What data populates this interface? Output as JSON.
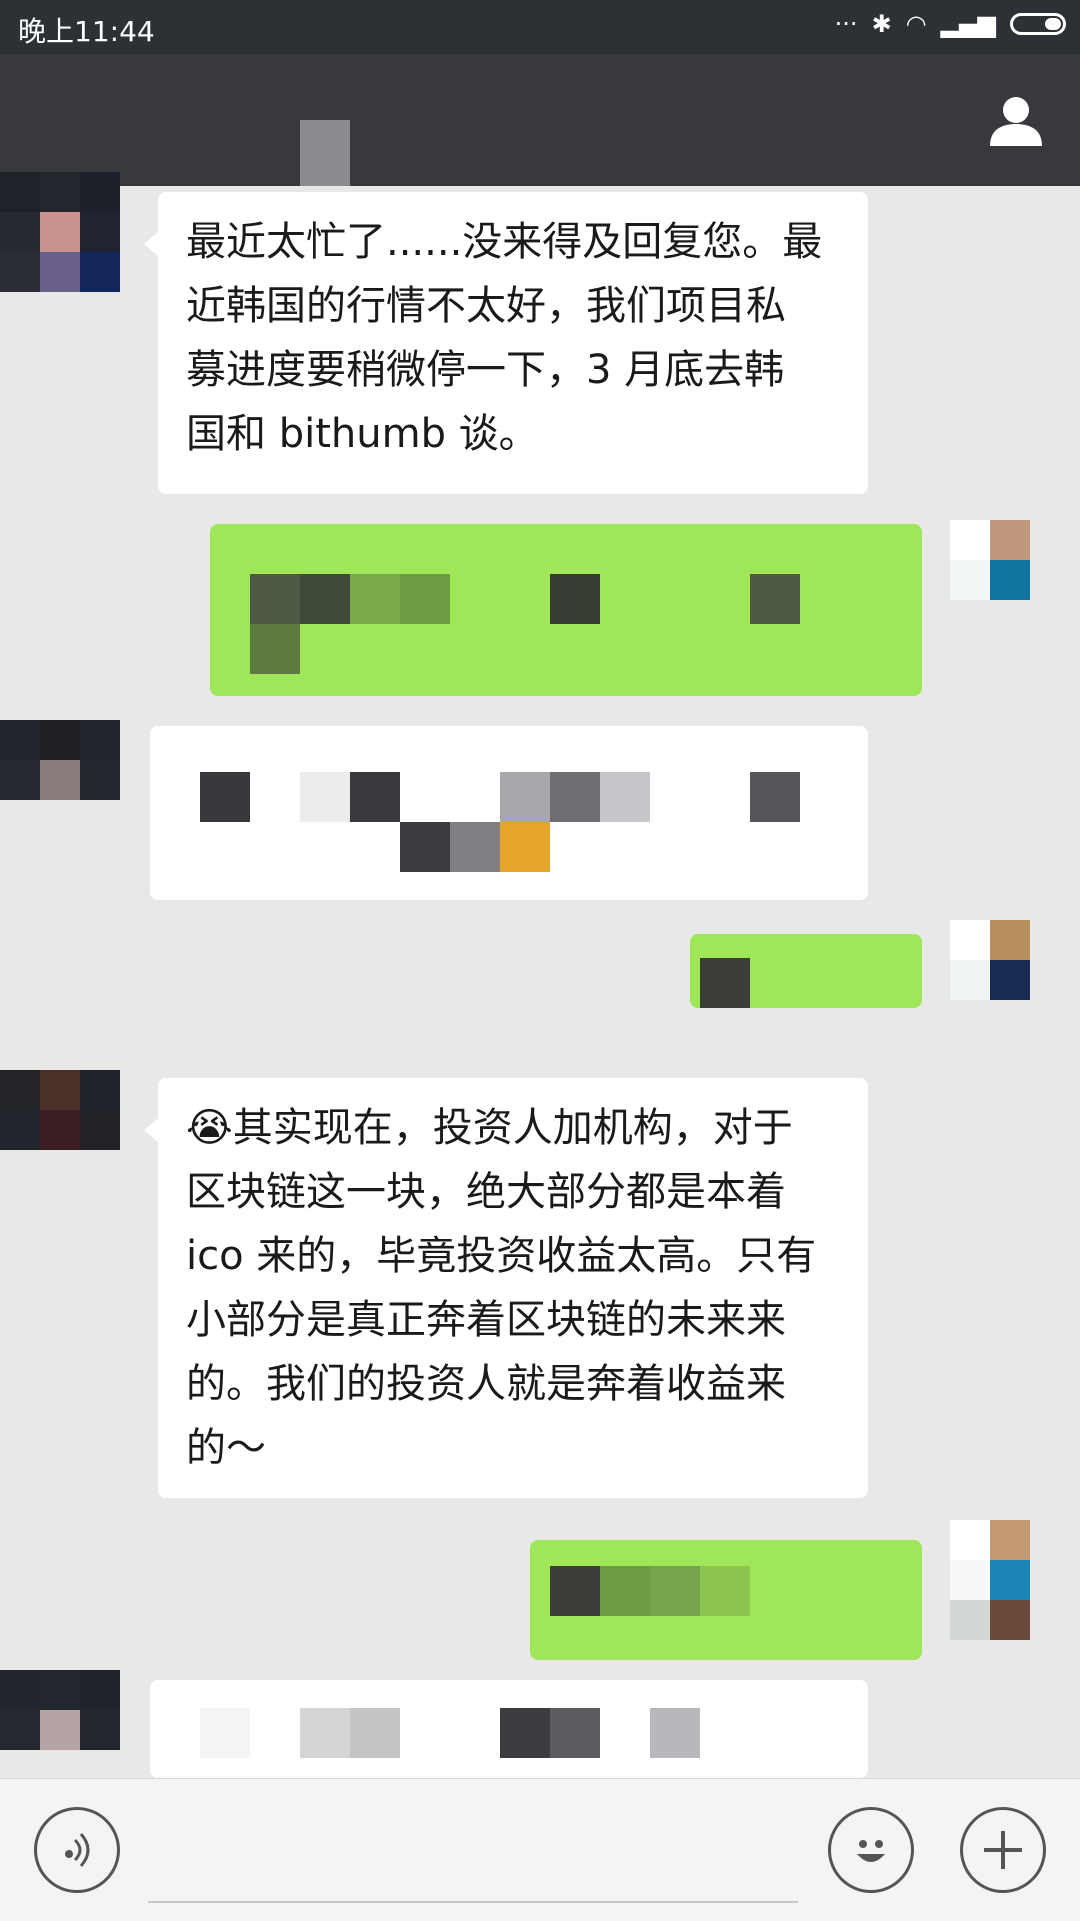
{
  "status_bar": {
    "time": "晚上11:44"
  },
  "messages": [
    {
      "side": "left",
      "lines": [
        "最近太忙了......没来得及回复您。最",
        "近韩国的行情不太好，我们项目私",
        "募进度要稍微停一下，3 月底去韩",
        "国和 bithumb 谈。"
      ]
    },
    {
      "side": "left",
      "lines": [
        "😭其实现在，投资人加机构，对于",
        "区块链这一块，绝大部分都是本着",
        "ico 来的，毕竟投资收益太高。只有",
        "小部分是真正奔着区块链的未来来",
        "的。我们的投资人就是奔着收益来",
        "的～"
      ]
    }
  ],
  "icons": {
    "profile": "person-icon",
    "voice": "voice-icon",
    "emoji": "emoji-icon",
    "plus": "plus-icon"
  },
  "colors": {
    "self_bubble": "#9fe659",
    "other_bubble": "#ffffff",
    "title_bar": "#37393d"
  }
}
